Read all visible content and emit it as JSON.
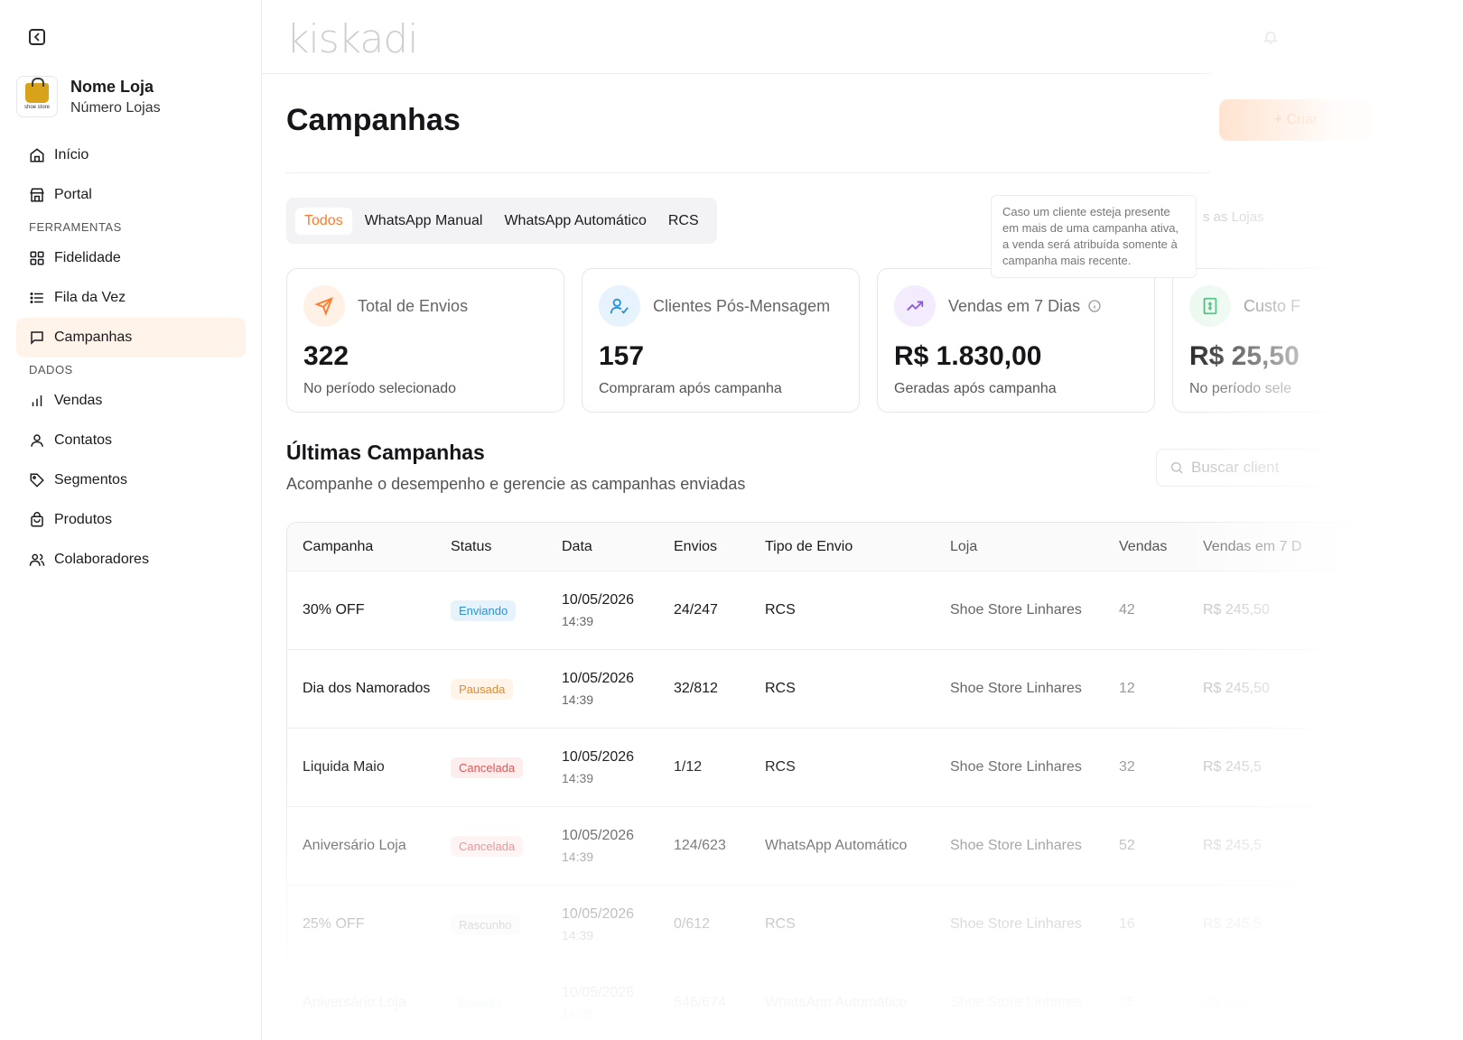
{
  "sidebar": {
    "store_name": "Nome Loja",
    "store_sub": "Número Lojas",
    "logo_text": "shoe store",
    "items": [
      {
        "label": "Início",
        "icon": "home-icon"
      },
      {
        "label": "Portal",
        "icon": "store-icon"
      }
    ],
    "section_tools": "FERRAMENTAS",
    "tools": [
      {
        "label": "Fidelidade",
        "icon": "grid-icon"
      },
      {
        "label": "Fila da Vez",
        "icon": "list-icon"
      },
      {
        "label": "Campanhas",
        "icon": "message-icon",
        "active": true
      }
    ],
    "section_data": "DADOS",
    "data_items": [
      {
        "label": "Vendas",
        "icon": "bar-chart-icon"
      },
      {
        "label": "Contatos",
        "icon": "user-icon"
      },
      {
        "label": "Segmentos",
        "icon": "tag-icon"
      },
      {
        "label": "Produtos",
        "icon": "bag-icon"
      },
      {
        "label": "Colaboradores",
        "icon": "users-icon"
      }
    ]
  },
  "header": {
    "brand": "kiskadi"
  },
  "page": {
    "title": "Campanhas",
    "new_button": "+ Criar"
  },
  "filters": {
    "tabs": [
      "Todos",
      "WhatsApp Manual",
      "WhatsApp Automático",
      "RCS"
    ],
    "active": "Todos",
    "store_select": "s as Lojas"
  },
  "tooltip": {
    "text": "Caso um cliente esteja presente em mais de uma campanha ativa, a venda será atribuída somente à campanha mais recente."
  },
  "cards": [
    {
      "label": "Total de Envios",
      "value": "322",
      "sub": "No período selecionado",
      "icon": "send-icon",
      "color": "#ff7a2b",
      "bg": "#fff1e6"
    },
    {
      "label": "Clientes Pós-Mensagem",
      "value": "157",
      "sub": "Compraram após campanha",
      "icon": "user-check-icon",
      "color": "#2a90d6",
      "bg": "#e7f3fc"
    },
    {
      "label": "Vendas em 7 Dias",
      "value": "R$ 1.830,00",
      "sub": "Geradas após campanha",
      "icon": "trending-up-icon",
      "color": "#8a5cd6",
      "bg": "#f2ecfc"
    },
    {
      "label": "Custo F",
      "value": "R$ 25,50",
      "sub": "No período sele",
      "icon": "receipt-icon",
      "color": "#2bb567",
      "bg": "#e9f8ee"
    }
  ],
  "section": {
    "title": "Últimas Campanhas",
    "subtitle": "Acompanhe o desempenho e gerencie as campanhas enviadas",
    "search_placeholder": "Buscar client"
  },
  "table": {
    "headers": [
      "Campanha",
      "Status",
      "Data",
      "Envios",
      "Tipo de Envio",
      "Loja",
      "Vendas",
      "Vendas em 7 D"
    ],
    "rows": [
      {
        "campanha": "30% OFF",
        "status": "Enviando",
        "status_class": "enviando",
        "data": "10/05/2026",
        "hora": "14:39",
        "envios": "24/247",
        "tipo": "RCS",
        "loja": "Shoe Store Linhares",
        "vendas": "42",
        "vendas7": "R$ 245,50"
      },
      {
        "campanha": "Dia dos Namorados",
        "status": "Pausada",
        "status_class": "pausada",
        "data": "10/05/2026",
        "hora": "14:39",
        "envios": "32/812",
        "tipo": "RCS",
        "loja": "Shoe Store Linhares",
        "vendas": "12",
        "vendas7": "R$ 245,50"
      },
      {
        "campanha": "Liquida Maio",
        "status": "Cancelada",
        "status_class": "cancelada",
        "data": "10/05/2026",
        "hora": "14:39",
        "envios": "1/12",
        "tipo": "RCS",
        "loja": "Shoe Store Linhares",
        "vendas": "32",
        "vendas7": "R$ 245,5"
      },
      {
        "campanha": "Aniversário Loja",
        "status": "Cancelada",
        "status_class": "cancelada",
        "data": "10/05/2026",
        "hora": "14:39",
        "envios": "124/623",
        "tipo": "WhatsApp Automático",
        "loja": "Shoe Store Linhares",
        "vendas": "52",
        "vendas7": "R$ 245,5"
      },
      {
        "campanha": "25% OFF",
        "status": "Rascunho",
        "status_class": "rascunho",
        "data": "10/05/2026",
        "hora": "14:39",
        "envios": "0/612",
        "tipo": "RCS",
        "loja": "Shoe Store Linhares",
        "vendas": "16",
        "vendas7": "R$ 245,5"
      },
      {
        "campanha": "Aniversário Loja",
        "status": "Enviada",
        "status_class": "enviada",
        "data": "10/05/2026",
        "hora": "14:39",
        "envios": "546/674",
        "tipo": "WhatsApp Automático",
        "loja": "Shoe Store Linhares",
        "vendas": "25",
        "vendas7": "R$ 245,5"
      }
    ]
  }
}
